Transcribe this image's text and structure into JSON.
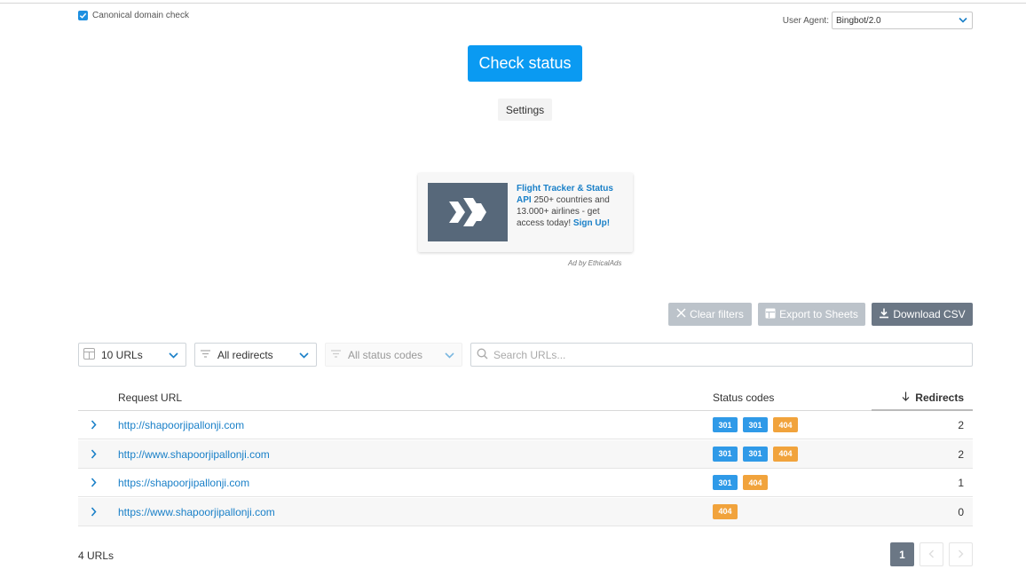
{
  "settings": {
    "canonical_label": "Canonical domain check",
    "canonical_checked": true,
    "user_agent_label": "User Agent:",
    "user_agent_value": "Bingbot/2.0"
  },
  "check_button": "Check status",
  "settings_button": "Settings",
  "ad": {
    "title": "Flight Tracker & Status API",
    "body": " 250+ countries and 13.000+ airlines - get access today! ",
    "cta": "Sign Up!",
    "byline": "Ad by EthicalAds"
  },
  "actions": {
    "clear_filters": "Clear filters",
    "export_sheets": "Export to Sheets",
    "download_csv": "Download CSV"
  },
  "filters": {
    "urls_count": "10 URLs",
    "redirects": "All redirects",
    "status_codes": "All status codes",
    "search_placeholder": "Search URLs..."
  },
  "table": {
    "columns": {
      "request_url": "Request URL",
      "status_codes": "Status codes",
      "redirects": "Redirects"
    },
    "rows": [
      {
        "url": "http://shapoorjipallonji.com",
        "codes": [
          "301",
          "301",
          "404"
        ],
        "redirects": "2"
      },
      {
        "url": "http://www.shapoorjipallonji.com",
        "codes": [
          "301",
          "301",
          "404"
        ],
        "redirects": "2"
      },
      {
        "url": "https://shapoorjipallonji.com",
        "codes": [
          "301",
          "404"
        ],
        "redirects": "1"
      },
      {
        "url": "https://www.shapoorjipallonji.com",
        "codes": [
          "404"
        ],
        "redirects": "0"
      }
    ]
  },
  "footer": {
    "total": "4 URLs",
    "page": "1"
  },
  "colors": {
    "primary": "#0a9af2",
    "link": "#1a80c8",
    "badge_301": "#2f9ae8",
    "badge_404": "#f1a33c",
    "dark_button": "#6b7785"
  }
}
